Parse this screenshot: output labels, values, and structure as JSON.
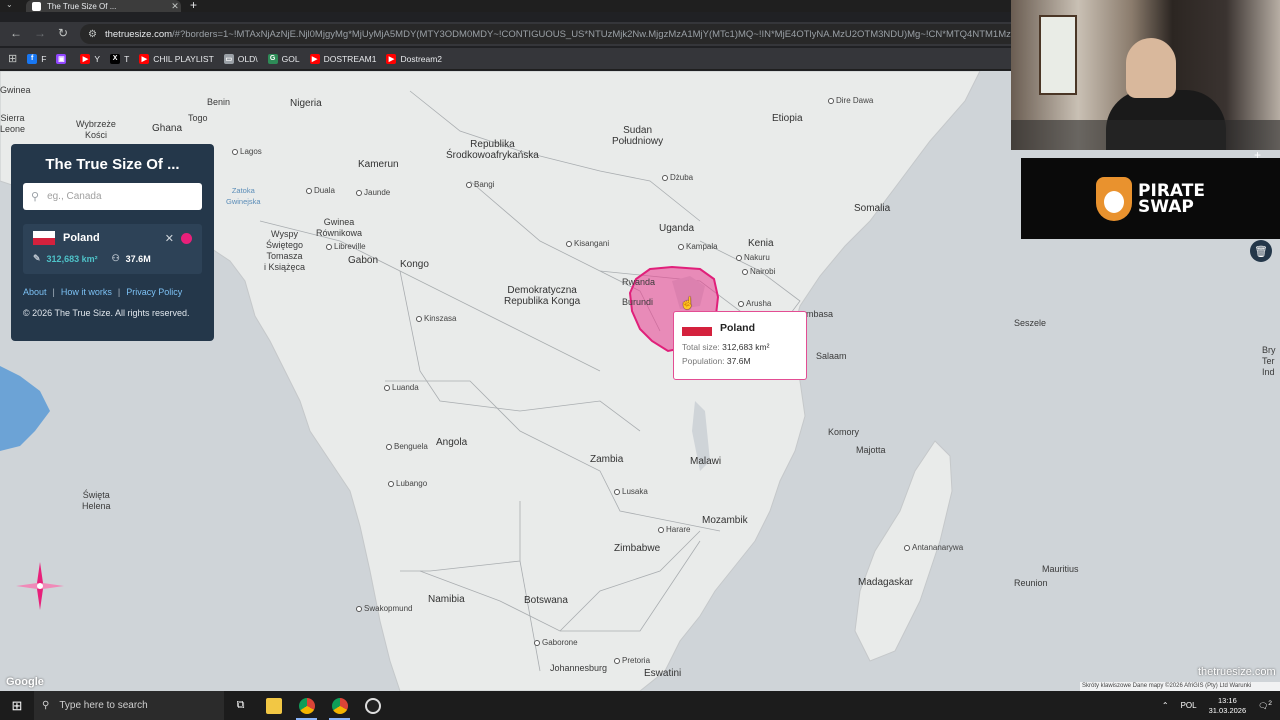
{
  "browser": {
    "tab_title": "The True Size Of ...",
    "url_host": "thetruesize.com",
    "url_rest": "/#?borders=1~!MTAxNjAzNjE.Njl0MjgyMg*MjUyMjA5MDY(MTY3ODM0MDY~!CONTIGUOUS_US*NTUzMjk2Nw.MjgzMzA1MjY(MTc1)MQ~!IN*MjE4OTlyNA.MzU2OTM3NDU)Mg~!CN*MTQ4NTM1Mzk.MTE",
    "bookmarks": [
      {
        "label": "F",
        "icon": "facebook-icon",
        "color": "#1877f2"
      },
      {
        "label": "",
        "icon": "twitch-icon",
        "color": "#9146ff"
      },
      {
        "label": "Y",
        "icon": "youtube-icon",
        "color": "#ff0000"
      },
      {
        "label": "T",
        "icon": "x-icon",
        "color": "#000000"
      },
      {
        "label": "CHIL PLAYLIST",
        "icon": "youtube-icon",
        "color": "#ff0000"
      },
      {
        "label": "OLD\\",
        "icon": "folder-icon",
        "color": "#9aa0a6"
      },
      {
        "label": "GOL",
        "icon": "g-icon",
        "color": "#2e8b57"
      },
      {
        "label": "DOSTREAM1",
        "icon": "youtube-icon",
        "color": "#ff0000"
      },
      {
        "label": "Dostream2",
        "icon": "youtube-icon",
        "color": "#ff0000"
      }
    ]
  },
  "panel": {
    "title": "The True Size Of ...",
    "search_placeholder": "eg., Canada",
    "country": {
      "name": "Poland",
      "area": "312,683 km²",
      "population": "37.6M",
      "dot_color": "#e8207a"
    },
    "links": [
      "About",
      "How it works",
      "Privacy Policy"
    ],
    "copyright": "© 2026 The True Size. All rights reserved."
  },
  "tooltip": {
    "country": "Poland",
    "total_label": "Total size:",
    "total_value": "312,683 km²",
    "population_label": "Population:",
    "population_value": "37.6M"
  },
  "map_labels": {
    "gwinea": "Gwinea",
    "sierra_leone": "Sierra\nLeone",
    "wybrzeze": "Wybrzeże\nKości",
    "ghana": "Ghana",
    "togo": "Togo",
    "benin": "Benin",
    "nigeria": "Nigeria",
    "lagos": "Lagos",
    "kamerun": "Kamerun",
    "duala": "Duala",
    "jaunde": "Jaunde",
    "zatoka": "Zatoka\nGwinejska",
    "gwinea_rownikowa": "Gwinea\nRównikowa",
    "libreville": "Libreville",
    "gabon": "Gabon",
    "wyspy": "Wyspy\nŚwiętego\nTomasza\ni Książęca",
    "kongo": "Kongo",
    "republika": "Republika\nŚrodkowoafrykańska",
    "bangi": "Bangi",
    "sudan_pd": "Sudan\nPołudniowy",
    "dzuba": "Dżuba",
    "etiopia": "Etiopia",
    "dire_dawa": "Dire Dawa",
    "somalia": "Somalia",
    "uganda": "Uganda",
    "kampala": "Kampala",
    "kenia": "Kenia",
    "nakuru": "Nakuru",
    "nairobi": "Nairobi",
    "kisangani": "Kisangani",
    "drk": "Demokratyczna\nRepublika Konga",
    "rwanda": "Rwanda",
    "burundi": "Burundi",
    "arusha": "Arusha",
    "mombasa": "mbasa",
    "salaam": "Salaam",
    "seszele": "Seszele",
    "kinszasa": "Kinszasa",
    "luanda": "Luanda",
    "angola": "Angola",
    "benguela": "Benguela",
    "lubango": "Lubango",
    "zambia": "Zambia",
    "lusaka": "Lusaka",
    "malawi": "Malawi",
    "komory": "Komory",
    "majotta": "Majotta",
    "mozambik": "Mozambik",
    "harare": "Harare",
    "zimbabwe": "Zimbabwe",
    "antananarywa": "Antananarywa",
    "madagaskar": "Madagaskar",
    "mauritius": "Mauritius",
    "reunion": "Reunion",
    "namibia": "Namibia",
    "botswana": "Botswana",
    "gaborone": "Gaborone",
    "pretoria": "Pretoria",
    "johannesburg": "Johannesburg",
    "eswatini": "Eswatini",
    "swakopmund": "Swakopmund",
    "swieta_helena": "Święta\nHelena",
    "bry": "Bry\nTer\nInd"
  },
  "map_footer": {
    "watermark": "thetruesize.com",
    "google": "Google",
    "attribution": "Skróty klawiszowe   Dane mapy ©2026 AfriGIS (Pty) Ltd   Warunki"
  },
  "sponsor": {
    "line1": "PIRATE",
    "line2": "SWAP"
  },
  "taskbar": {
    "search_placeholder": "Type here to search",
    "language": "POL",
    "time": "13:16",
    "date": "31.03.2026",
    "notification_count": "2"
  }
}
